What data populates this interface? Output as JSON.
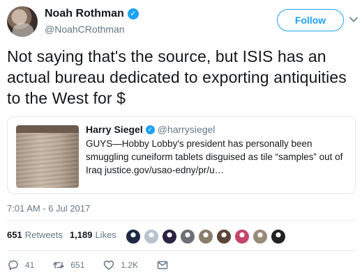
{
  "author": {
    "name": "Noah Rothman",
    "handle": "@NoahCRothman",
    "verified": true
  },
  "follow_label": "Follow",
  "tweet_text": "Not saying that's the source, but ISIS has an actual bureau dedicated to exporting antiquities to the West for $",
  "quoted_tweet": {
    "name": "Harry Siegel",
    "handle": "@harrysiegel",
    "verified": true,
    "text": "GUYS—Hobby Lobby's president has personally been smuggling cuneiform tablets disguised as tile “samples” out of Iraq justice.gov/usao-edny/pr/u…"
  },
  "timestamp": "7:01 AM - 6 Jul 2017",
  "stats": {
    "retweets_count": "651",
    "retweets_label": "Retweets",
    "likes_count": "1,189",
    "likes_label": "Likes"
  },
  "liker_avatars": [
    "#1f2a44",
    "#b9c3cc",
    "#2b2340",
    "#6c6f75",
    "#8a7e6a",
    "#5b4638",
    "#c2476a",
    "#9a8a7a",
    "#222222"
  ],
  "actions": {
    "reply_count": "41",
    "retweet_count": "651",
    "like_count": "1.2K"
  },
  "colors": {
    "accent": "#1da1f2",
    "text": "#14171a",
    "secondary": "#657786",
    "border": "#e1e8ed"
  }
}
